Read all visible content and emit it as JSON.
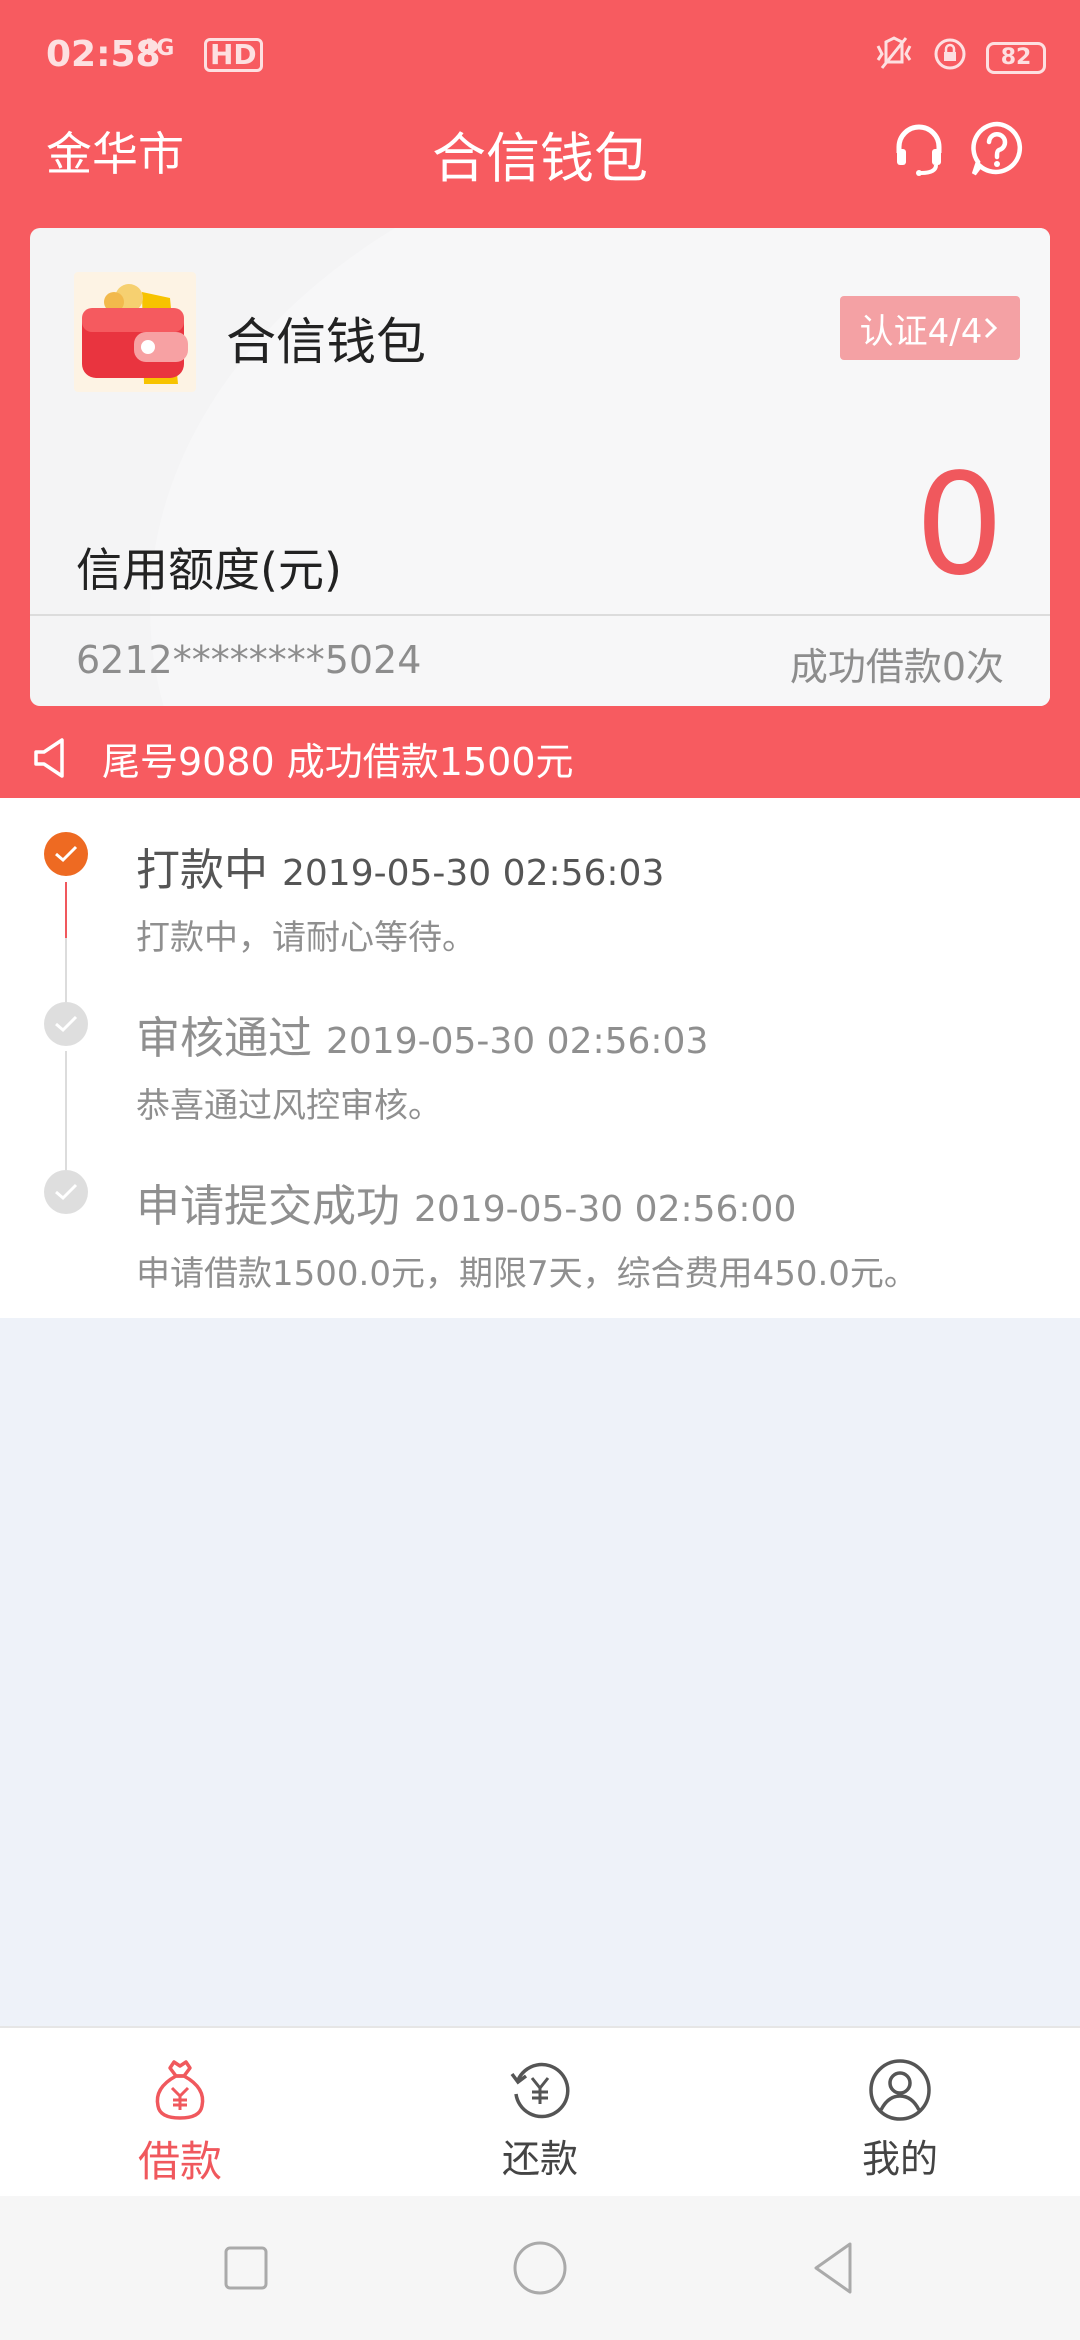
{
  "status_bar": {
    "time": "02:58",
    "signal": "4G",
    "hd": "HD",
    "battery": "82"
  },
  "nav": {
    "city": "金华市",
    "title": "合信钱包",
    "support_icon": "headset-icon",
    "help_icon": "help-icon"
  },
  "card": {
    "app_name": "合信钱包",
    "logo_icon": "wallet-icon",
    "certification": "认证4/4",
    "credit_label": "信用额度(元)",
    "credit_value": "0",
    "account": "6212********5024",
    "success_count": "成功借款0次"
  },
  "notice": {
    "icon": "speaker-icon",
    "text": "尾号9080 成功借款1500元"
  },
  "timeline": [
    {
      "title": "打款中",
      "time": "2019-05-30 02:56:03",
      "desc": "打款中，请耐心等待。",
      "active": true
    },
    {
      "title": "审核通过",
      "time": "2019-05-30 02:56:03",
      "desc": "恭喜通过风控审核。",
      "active": false
    },
    {
      "title": "申请提交成功",
      "time": "2019-05-30 02:56:00",
      "desc": "申请借款1500.0元，期限7天，综合费用450.0元。",
      "active": false
    }
  ],
  "tabs": [
    {
      "label": "借款",
      "icon": "money-bag-icon",
      "active": true
    },
    {
      "label": "还款",
      "icon": "repay-icon",
      "active": false
    },
    {
      "label": "我的",
      "icon": "user-icon",
      "active": false
    }
  ],
  "colors": {
    "brand": "#f75b60",
    "accent": "#f0585d",
    "progress_active": "#ee6a22"
  }
}
